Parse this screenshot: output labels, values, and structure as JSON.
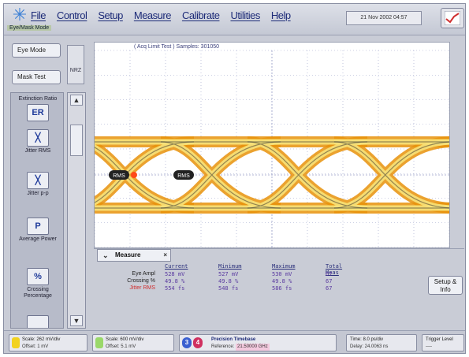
{
  "menubar": {
    "logo_icon": "scope-star-icon",
    "mode_label": "Eye/Mask Mode",
    "items": [
      "File",
      "Control",
      "Setup",
      "Measure",
      "Calibrate",
      "Utilities",
      "Help"
    ],
    "datetime": "21 Nov 2002  04:57",
    "trend_icon": "trend-chart-icon"
  },
  "left": {
    "eye_mode": "Eye Mode",
    "mask_test": "Mask Test",
    "nrz": "NRZ",
    "tools": [
      {
        "icon_text": "ER",
        "label": "Extinction Ratio",
        "icon": "extinction-ratio-icon"
      },
      {
        "icon_text": "╳",
        "label": "Jitter RMS",
        "icon": "jitter-rms-icon"
      },
      {
        "icon_text": "╳",
        "label": "Jitter p-p",
        "icon": "jitter-pp-icon"
      },
      {
        "icon_text": "P",
        "label": "Average Power",
        "icon": "average-power-icon"
      },
      {
        "icon_text": "%",
        "label": "Crossing Percentage",
        "icon": "crossing-percentage-icon"
      }
    ]
  },
  "display": {
    "title": "( Acq Limit Test ) Samples: 301050",
    "markers": [
      "RMS",
      "RMS"
    ],
    "colors": {
      "eye_outer": "#e8920a",
      "eye_inner": "#f7e27a",
      "edge": "#2f2f2f",
      "grid": "#9aa0c8",
      "marker": "#222222",
      "marker_hit": "#ff4a1a"
    }
  },
  "measure": {
    "tab_label": "Measure",
    "headers": [
      "Current",
      "Minimum",
      "Maximum",
      "Total Meas"
    ],
    "rows": [
      {
        "name": "Eye Ampl",
        "color": "dark",
        "values": [
          "528 mV",
          "527 mV",
          "530 mV",
          "67"
        ]
      },
      {
        "name": "Crossing %",
        "color": "dark",
        "values": [
          "49.8 %",
          "49.8 %",
          "49.8 %",
          "67"
        ]
      },
      {
        "name": "Jitter RMS",
        "color": "red",
        "values": [
          "554 fs",
          "548 fs",
          "586 fs",
          "67"
        ]
      }
    ],
    "setup_label": "Setup & Info"
  },
  "statusbar": {
    "ch1": {
      "line1": "Scale: 262 mV/div",
      "line2": "Offset: 1 mV",
      "color": "#f2d21e"
    },
    "ch2": {
      "line1": "Scale: 600 mV/div",
      "line2": "Offset: 5.1 mV",
      "color": "#9ad86a"
    },
    "timebase": {
      "badge1": "3",
      "badge2": "4",
      "title": "Precision Timebase",
      "ref_label": "Reference:",
      "ref_value": "21.50000 GHz"
    },
    "time": {
      "line1": "Time: 8.0 ps/div",
      "line2": "Delay: 24.0063 ns"
    },
    "trigger": {
      "line1": "Trigger Level",
      "line2": "----"
    }
  }
}
